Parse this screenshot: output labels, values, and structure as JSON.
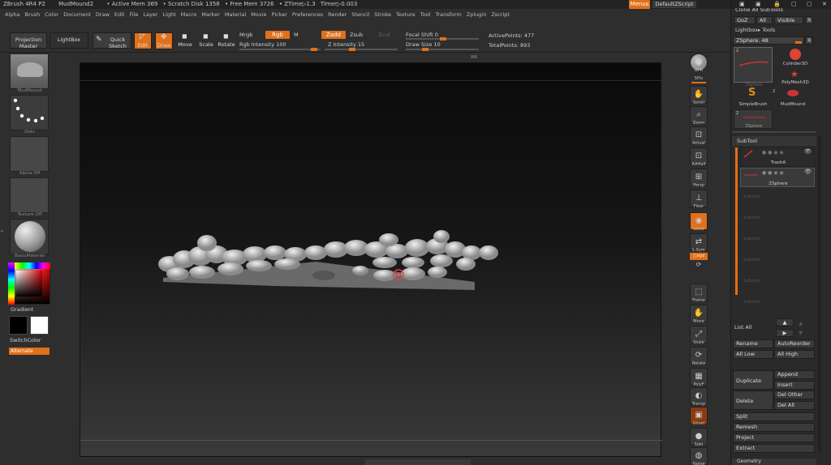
{
  "titlebar": {
    "app": "ZBrush 4R4 P2",
    "doc": "MudMound2",
    "active_mem": "• Active Mem 369",
    "scratch": "• Scratch Disk 1358",
    "free_mem": "• Free Mem 3726",
    "ztime": "• ZTime▷1.3",
    "timer": "Timer▷0.003",
    "menus_btn": "Menus",
    "script_btn": "DefaultZScript"
  },
  "menubar": [
    "Alpha",
    "Brush",
    "Color",
    "Document",
    "Draw",
    "Edit",
    "File",
    "Layer",
    "Light",
    "Macro",
    "Marker",
    "Material",
    "Movie",
    "Picker",
    "Preferences",
    "Render",
    "Stencil",
    "Stroke",
    "Texture",
    "Tool",
    "Transform",
    "Zplugin",
    "Zscript"
  ],
  "toolbar": {
    "projection_master": "Projection Master",
    "lightbox": "LightBox",
    "quick_sketch": "Quick Sketch",
    "edit": "Edit",
    "draw": "Draw",
    "move": "Move",
    "scale": "Scale",
    "rotate": "Rotate",
    "mrgb": "Mrgb",
    "rgb": "Rgb",
    "m": "M",
    "rgb_intensity": "Rgb Intensity 100",
    "zadd": "Zadd",
    "zsub": "Zsub",
    "zcut": "Zcut",
    "z_intensity": "Z Intensity 15",
    "focal_shift": "Focal Shift 0",
    "draw_size": "Draw Size 10",
    "active_points": "ActivePoints: 477",
    "total_points": "TotalPoints: 893"
  },
  "leftshelf": {
    "brush_label": "MudMound",
    "stroke_label": "Dots",
    "alpha_label": "Alpha Off",
    "texture_label": "Texture Off",
    "material_label": "BasicMaterial",
    "gradient": "Gradient",
    "switchcolor": "SwitchColor",
    "alternate": "Alternate"
  },
  "rightshelf": {
    "bpr": "BPR",
    "spix": "SPix",
    "scroll": "Scroll",
    "zoom": "Zoom",
    "actual": "Actual",
    "aahalf": "AAHalf",
    "persp": "Persp",
    "floor": "Floor",
    "local": "Local",
    "lsym": "L.Sym",
    "xyz": "○xyz",
    "frame": "Frame",
    "move": "Move",
    "scale": "Scale",
    "rotate": "Rotate",
    "polyf": "PolyF",
    "transp": "Transp",
    "ghost": "Ghost",
    "solo": "Solo",
    "xpose": "Xpose"
  },
  "tray": {
    "clone_all": "Clone All SubTools",
    "goz": "GoZ",
    "all": "All",
    "visible": "Visible",
    "r": "R",
    "lightbox_tools": "Lightbox▸ Tools",
    "zsphere_slider": "ZSphere. 48",
    "tools": [
      {
        "name": "ZSphere",
        "count": "2"
      },
      {
        "name": "Cylinder3D",
        "count": ""
      },
      {
        "name": "PolyMesh3D",
        "count": ""
      },
      {
        "name": "SimpleBrush",
        "count": ""
      },
      {
        "name": "MudMound",
        "count": "2"
      },
      {
        "name": "ZSphere",
        "count": "2"
      }
    ],
    "subtool_title": "SubTool",
    "subtools": [
      "TrashA",
      "ZSphere"
    ],
    "empty_subtool": "Subtool",
    "list_all": "List All",
    "rename": "Rename",
    "autoreorder": "AutoReorder",
    "all_low": "All Low",
    "all_high": "All High",
    "duplicate": "Duplicate",
    "append": "Append",
    "insert": "Insert",
    "delete": "Delete",
    "del_other": "Del Other",
    "del_all": "Del All",
    "split": "Split",
    "remesh": "Remesh",
    "project": "Project",
    "extract": "Extract",
    "geometry": "Geometry"
  },
  "colors": {
    "accent": "#e0701a",
    "primary_color": "#000000",
    "secondary_color": "#ffffff"
  }
}
